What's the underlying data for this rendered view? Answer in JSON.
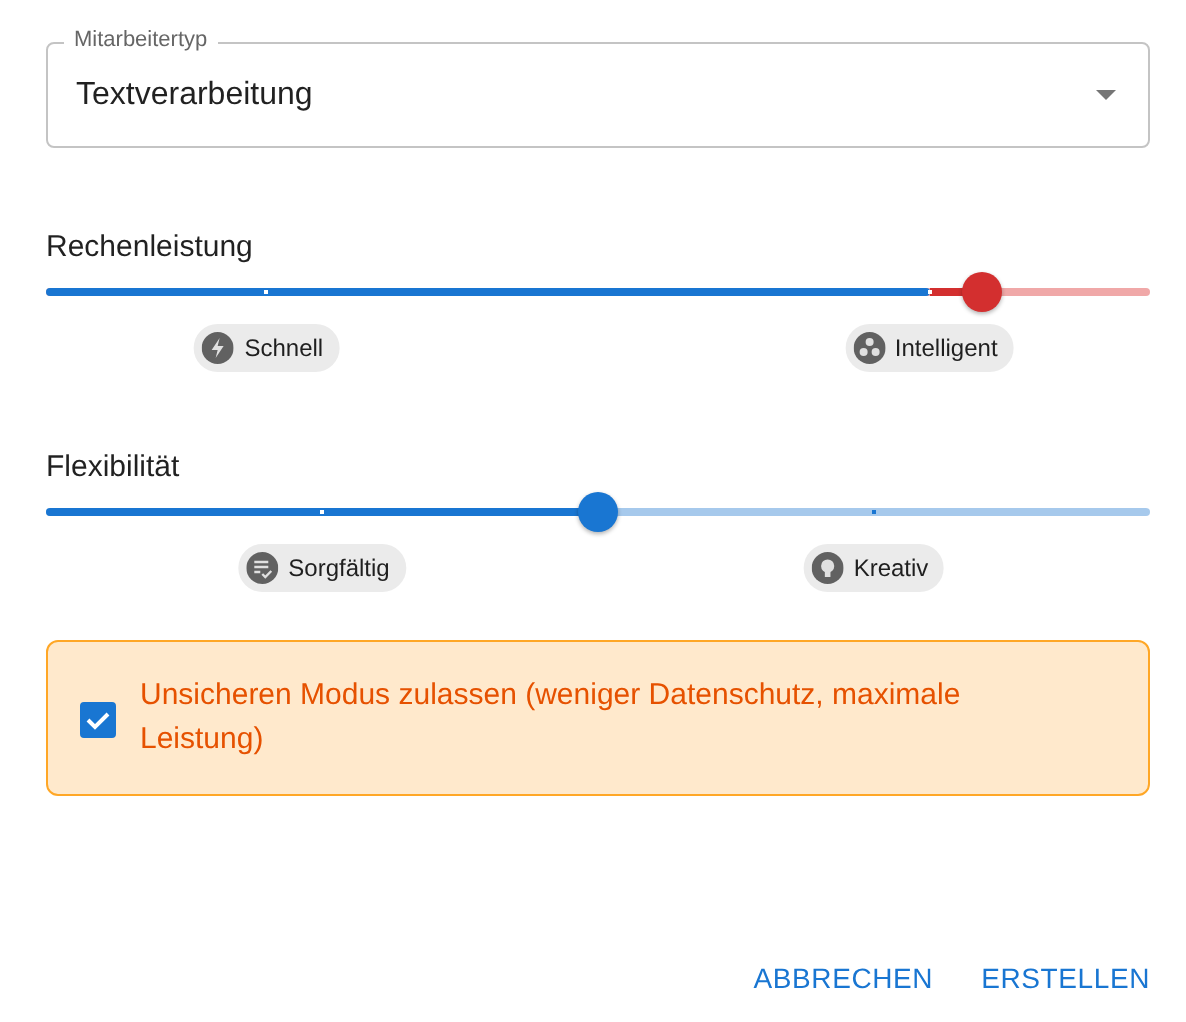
{
  "select": {
    "label": "Mitarbeitertyp",
    "value": "Textverarbeitung"
  },
  "sliders": [
    {
      "label": "Rechenleistung",
      "level": 0.848,
      "warning": true,
      "marks": [
        {
          "label": "Schnell"
        },
        {
          "label": "Intelligent"
        }
      ]
    },
    {
      "label": "Flexibilität",
      "level": 0.5,
      "warning": false,
      "marks": [
        {
          "label": "Sorgfältig"
        },
        {
          "label": "Kreativ"
        }
      ]
    }
  ],
  "alert": {
    "checked": true,
    "text": "Unsicheren Modus zulassen (weniger Datenschutz, maximale Leistung)"
  },
  "buttons": [
    "ABBRECHEN",
    "ERSTELLEN"
  ]
}
